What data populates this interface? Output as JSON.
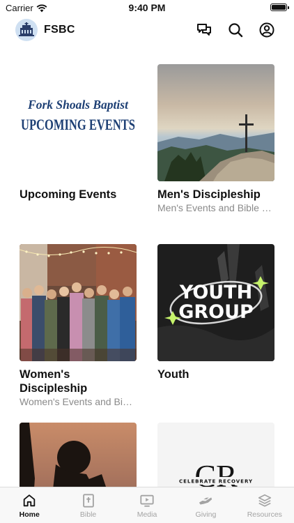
{
  "status_bar": {
    "carrier": "Carrier",
    "time": "9:40 PM"
  },
  "header": {
    "title": "FSBC"
  },
  "cards": [
    {
      "title": "Upcoming Events",
      "subtitle": "",
      "art_line1": "Fork Shoals Baptist",
      "art_line2": "UPCOMING EVENTS"
    },
    {
      "title": "Men's Discipleship",
      "subtitle": "Men's Events and Bible Studies"
    },
    {
      "title": "Women's Discipleship",
      "subtitle": "Women's Events and Bible Studies"
    },
    {
      "title": "Youth",
      "subtitle": "",
      "art_line1": "YOUTH",
      "art_line2": "GROUP"
    },
    {
      "title": "",
      "subtitle": ""
    },
    {
      "title": "",
      "subtitle": "",
      "art_line1": "CR",
      "art_line2": "CELEBRATE RECOVERY"
    }
  ],
  "tabs": [
    {
      "label": "Home",
      "icon": "home-icon",
      "active": true
    },
    {
      "label": "Bible",
      "icon": "bible-icon",
      "active": false
    },
    {
      "label": "Media",
      "icon": "media-icon",
      "active": false
    },
    {
      "label": "Giving",
      "icon": "giving-icon",
      "active": false
    },
    {
      "label": "Resources",
      "icon": "resources-icon",
      "active": false
    }
  ]
}
